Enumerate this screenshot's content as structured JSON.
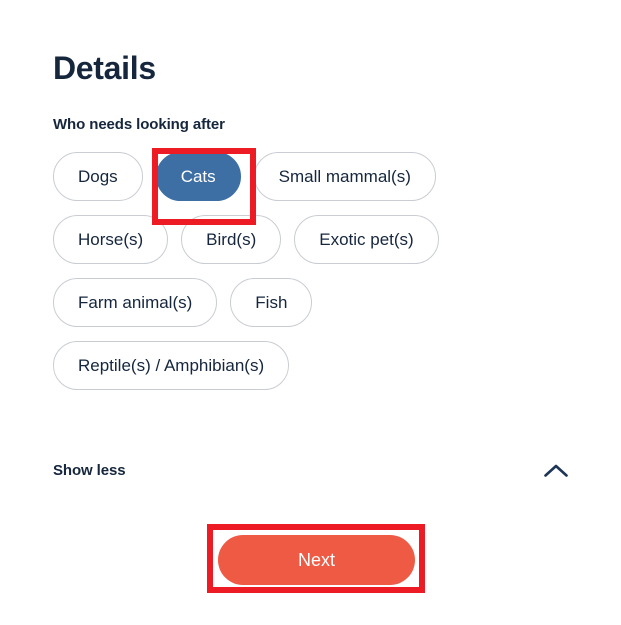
{
  "page": {
    "title": "Details"
  },
  "details_form": {
    "field_label": "Who needs looking after",
    "chips": [
      {
        "label": "Dogs",
        "selected": false
      },
      {
        "label": "Cats",
        "selected": true
      },
      {
        "label": "Small mammal(s)",
        "selected": false
      },
      {
        "label": "Horse(s)",
        "selected": false
      },
      {
        "label": "Bird(s)",
        "selected": false
      },
      {
        "label": "Exotic pet(s)",
        "selected": false
      },
      {
        "label": "Farm animal(s)",
        "selected": false
      },
      {
        "label": "Fish",
        "selected": false
      },
      {
        "label": "Reptile(s) / Amphibian(s)",
        "selected": false
      }
    ],
    "show_toggle": {
      "label": "Show less",
      "icon": "chevron-up-icon"
    },
    "next_label": "Next"
  },
  "annotations": [
    {
      "target": "Cats",
      "color": "#ed1c24"
    },
    {
      "target": "Next",
      "color": "#ed1c24"
    }
  ],
  "colors": {
    "text_navy": "#15263d",
    "chip_border": "#c9cdd3",
    "chip_selected_bg": "#3d6fa5",
    "primary_button_bg": "#ef5a45",
    "annotation_red": "#ed1c24",
    "background": "#ffffff"
  }
}
